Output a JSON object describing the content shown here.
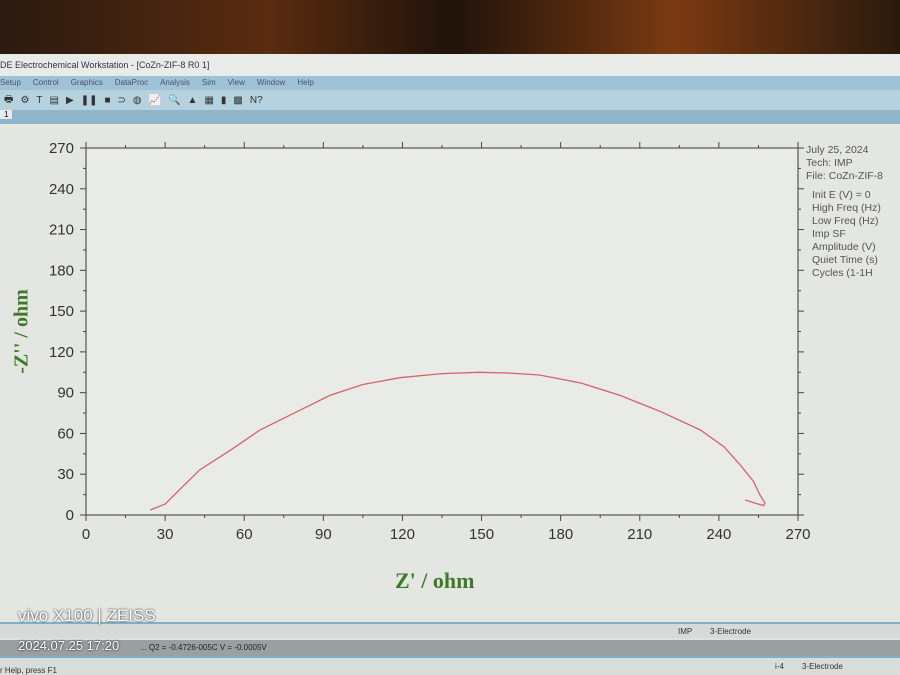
{
  "window": {
    "title": "DE Electrochemical Workstation - [CoZn-ZIF-8 R0 1]"
  },
  "menu": [
    "Setup",
    "Control",
    "Graphics",
    "DataProc",
    "Analysis",
    "Sim",
    "View",
    "Window",
    "Help"
  ],
  "tab": "1",
  "info": {
    "date": "July 25, 2024",
    "tech": "Tech: IMP",
    "file": "File: CoZn-ZIF-8",
    "params": [
      "Init E (V) = 0",
      "High Freq (Hz)",
      "Low Freq (Hz)",
      "Imp SF",
      "Amplitude (V)",
      "Quiet Time (s)",
      "Cycles (1-1H"
    ]
  },
  "status": {
    "bar1_tech": "IMP",
    "bar1_mode": "3-Electrode",
    "bar2_text": "... Q2 = -0.4726-005C  V = -0.0005V",
    "bar3_left": "r Help, press F1",
    "bar3_id": "i-4",
    "bar3_mode": "3-Electrode"
  },
  "watermark": {
    "camera": "vivo X100 | ZEISS",
    "timestamp": "2024.07.25 17:20"
  },
  "colors": {
    "curve": "#d9606a",
    "axis_label": "#3d7a2a"
  },
  "chart_data": {
    "type": "line",
    "xlabel": "Z' / ohm",
    "ylabel": "-Z'' / ohm",
    "xlim": [
      0,
      270
    ],
    "ylim": [
      0,
      270
    ],
    "xticks": [
      0,
      30,
      60,
      90,
      120,
      150,
      180,
      210,
      240,
      270
    ],
    "yticks": [
      0,
      30,
      60,
      90,
      120,
      150,
      180,
      210,
      240,
      270
    ],
    "series": [
      {
        "name": "CoZn-ZIF-8",
        "x": [
          24.3,
          30,
          43,
          55,
          66,
          80,
          92.5,
          105,
          119,
          135,
          149,
          160,
          172,
          188,
          202.5,
          218,
          233,
          242,
          248,
          253,
          255.6,
          257.5,
          257,
          254,
          250
        ],
        "y": [
          3.7,
          8,
          33,
          48,
          62.5,
          76,
          88,
          96,
          101,
          104,
          105,
          104.5,
          103,
          97,
          88,
          76,
          62.5,
          50,
          37,
          25,
          14.7,
          8.8,
          7,
          8.5,
          11
        ]
      }
    ]
  }
}
